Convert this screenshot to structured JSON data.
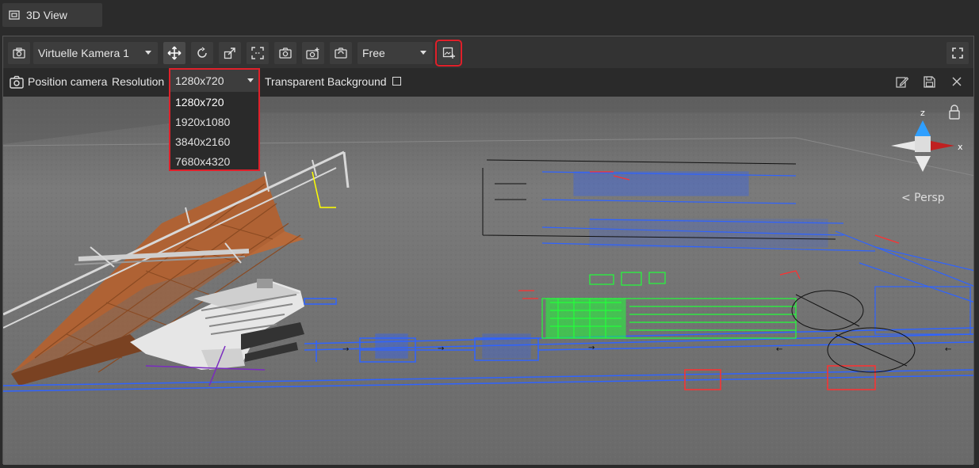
{
  "tab": {
    "icon": "viewport-icon",
    "label": "3D View"
  },
  "toolbar": {
    "camera_select": "Virtuelle Kamera 1",
    "mode_select": "Free",
    "icons": [
      "camera-icon",
      "move-icon",
      "rotate-icon",
      "scale-icon",
      "frame-icon",
      "snapshot-icon",
      "add-camera-icon",
      "camera-settings-icon",
      "add-screenshot-icon",
      "fullscreen-icon"
    ]
  },
  "options": {
    "position_camera": "Position camera",
    "resolution_label": "Resolution",
    "resolution_value": "1280x720",
    "transparent_label": "Transparent Background"
  },
  "resolution_options": [
    "1280x720",
    "1920x1080",
    "3840x2160",
    "7680x4320"
  ],
  "gizmo": {
    "z": "z",
    "x": "x",
    "persp": "< Persp"
  },
  "colors": {
    "highlight": "#e0202a",
    "blueprint_blue": "#2f63ff",
    "blueprint_green": "#22ff3a",
    "blueprint_red": "#ff3030",
    "wood": "#b86a3a"
  }
}
